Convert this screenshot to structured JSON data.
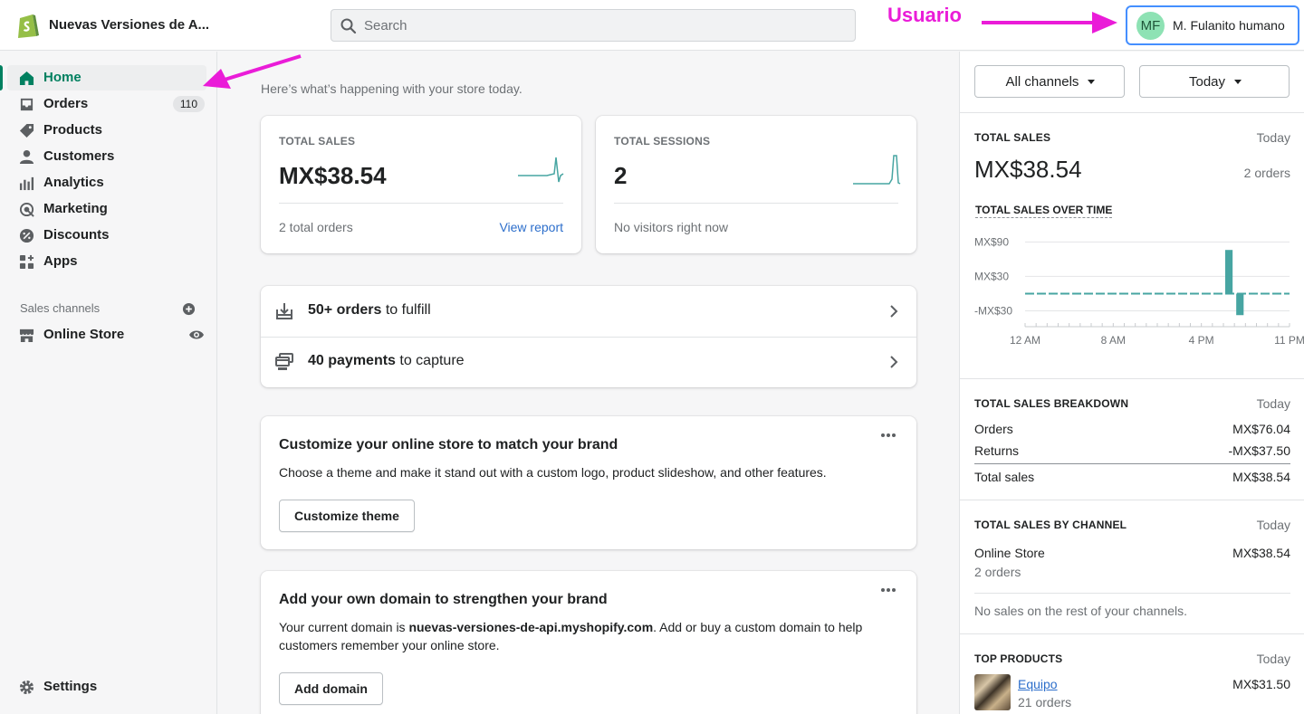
{
  "header": {
    "store_name": "Nuevas Versiones de A...",
    "search_placeholder": "Search",
    "annotation_label": "Usuario",
    "user_initials": "MF",
    "user_name": "M. Fulanito humano"
  },
  "sidebar": {
    "items": [
      {
        "label": "Home",
        "icon": "home-icon"
      },
      {
        "label": "Orders",
        "icon": "orders-icon",
        "badge": "110"
      },
      {
        "label": "Products",
        "icon": "tag-icon"
      },
      {
        "label": "Customers",
        "icon": "person-icon"
      },
      {
        "label": "Analytics",
        "icon": "bar-chart-icon"
      },
      {
        "label": "Marketing",
        "icon": "target-icon"
      },
      {
        "label": "Discounts",
        "icon": "discount-icon"
      },
      {
        "label": "Apps",
        "icon": "apps-icon"
      }
    ],
    "sales_channels_label": "Sales channels",
    "channels": [
      {
        "label": "Online Store",
        "icon": "store-icon"
      }
    ],
    "settings_label": "Settings"
  },
  "main": {
    "subtitle": "Here’s what’s happening with your store today.",
    "kpis": [
      {
        "title": "TOTAL SALES",
        "value": "MX$38.54",
        "footer": "2 total orders",
        "link": "View report"
      },
      {
        "title": "TOTAL SESSIONS",
        "value": "2",
        "footer": "No visitors right now"
      }
    ],
    "tasks": [
      {
        "bold": "50+ orders",
        "rest": " to fulfill"
      },
      {
        "bold": "40 payments",
        "rest": " to capture"
      }
    ],
    "promos": [
      {
        "title": "Customize your online store to match your brand",
        "text": "Choose a theme and make it stand out with a custom logo, product slideshow, and other features.",
        "button": "Customize theme"
      },
      {
        "title": "Add your own domain to strengthen your brand",
        "text_before": "Your current domain is ",
        "text_bold": "nuevas-versiones-de-api.myshopify.com",
        "text_after": ". Add or buy a custom domain to help customers remember your online store.",
        "button": "Add domain"
      }
    ]
  },
  "right_panel": {
    "channel_filter": "All channels",
    "date_filter": "Today",
    "total_sales": {
      "title": "TOTAL SALES",
      "period": "Today",
      "value": "MX$38.54",
      "orders": "2 orders",
      "chart_title": "TOTAL SALES OVER TIME"
    },
    "breakdown": {
      "title": "TOTAL SALES BREAKDOWN",
      "period": "Today",
      "rows": [
        {
          "label": "Orders",
          "value": "MX$76.04"
        },
        {
          "label": "Returns",
          "value": "-MX$37.50"
        },
        {
          "label": "Total sales",
          "value": "MX$38.54"
        }
      ]
    },
    "by_channel": {
      "title": "TOTAL SALES BY CHANNEL",
      "period": "Today",
      "channel": "Online Store",
      "value": "MX$38.54",
      "orders": "2 orders",
      "note": "No sales on the rest of your channels."
    },
    "top_products": {
      "title": "TOP PRODUCTS",
      "period": "Today",
      "name": "Equipo",
      "value": "MX$31.50",
      "orders": "21 orders"
    }
  },
  "chart_data": {
    "type": "bar",
    "title": "TOTAL SALES OVER TIME",
    "y_tick_labels": [
      "MX$90",
      "MX$30",
      "-MX$30"
    ],
    "y_ticks": [
      90,
      30,
      -30
    ],
    "ylim": [
      -45,
      100
    ],
    "x_tick_labels": [
      "12 AM",
      "8 AM",
      "4 PM",
      "11 PM"
    ],
    "x": [
      "0",
      "1",
      "2",
      "3",
      "4",
      "5",
      "6",
      "7",
      "8",
      "9",
      "10",
      "11",
      "12",
      "13",
      "14",
      "15",
      "16",
      "17",
      "18",
      "19",
      "20",
      "21",
      "22",
      "23"
    ],
    "values": [
      0,
      0,
      0,
      0,
      0,
      0,
      0,
      0,
      0,
      0,
      0,
      0,
      0,
      0,
      0,
      0,
      0,
      0,
      76.04,
      -37.5,
      0,
      0,
      0,
      0
    ],
    "bar_color": "#47a5a2"
  }
}
